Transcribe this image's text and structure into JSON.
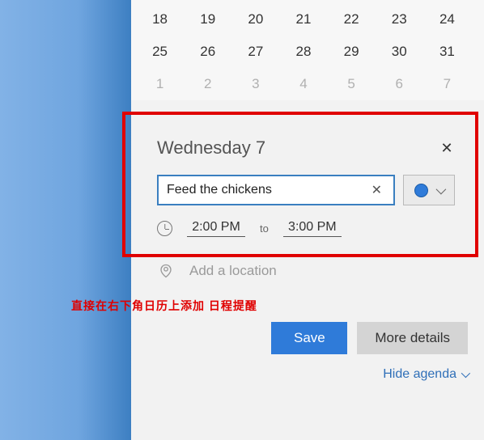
{
  "calendar": {
    "rows": [
      {
        "cells": [
          "18",
          "19",
          "20",
          "21",
          "22",
          "23",
          "24"
        ],
        "dim": false
      },
      {
        "cells": [
          "25",
          "26",
          "27",
          "28",
          "29",
          "30",
          "31"
        ],
        "dim": false
      },
      {
        "cells": [
          "1",
          "2",
          "3",
          "4",
          "5",
          "6",
          "7"
        ],
        "dim": true
      }
    ]
  },
  "popup": {
    "title": "Wednesday 7",
    "close": "✕",
    "event_name": "Feed the chickens",
    "clear": "✕",
    "start_time": "2:00 PM",
    "to_label": "to",
    "end_time": "3:00 PM",
    "location_placeholder": "Add a location"
  },
  "buttons": {
    "save": "Save",
    "more": "More details"
  },
  "hide_agenda": "Hide agenda",
  "annotation": "直接在右下角日历上添加 日程提醒"
}
